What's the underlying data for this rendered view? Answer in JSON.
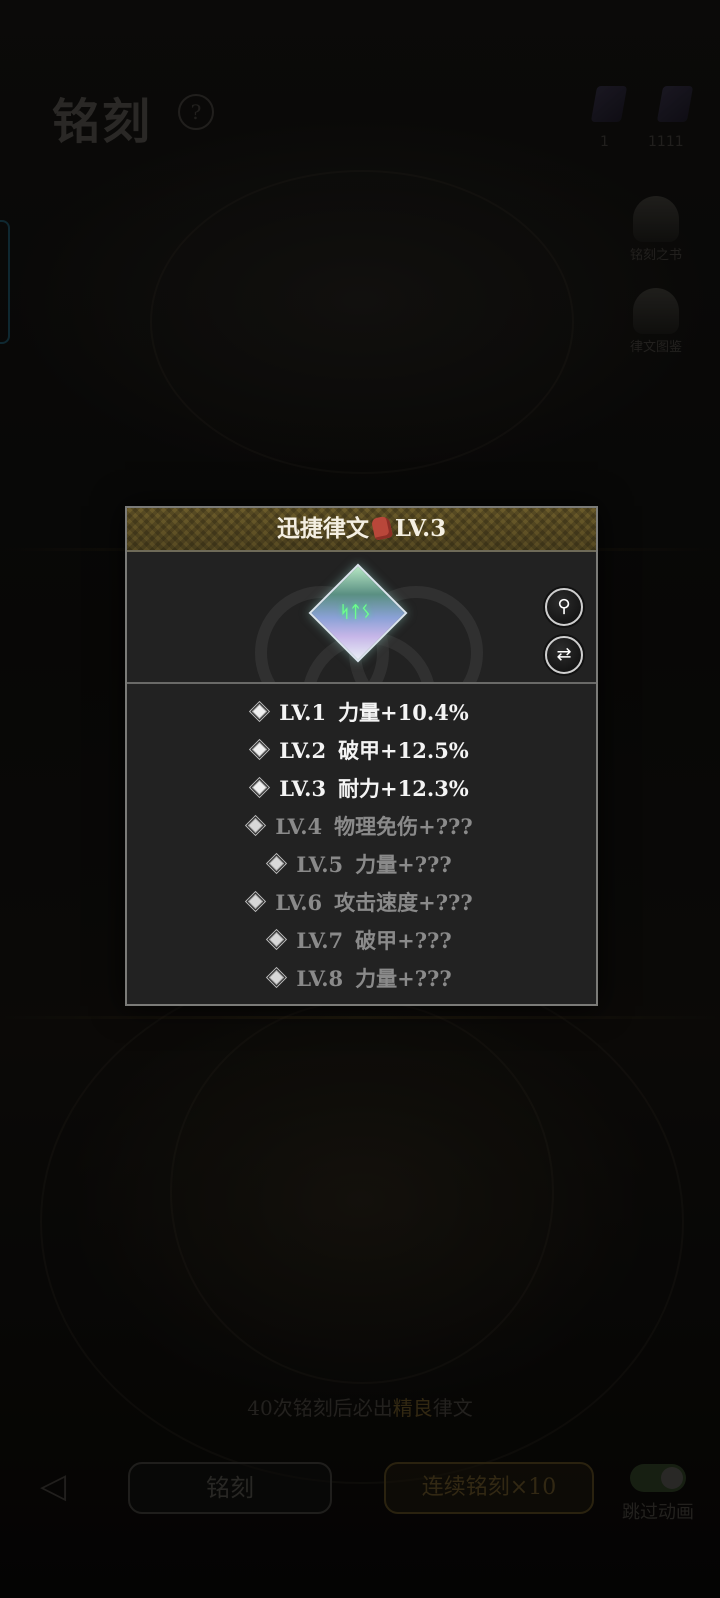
{
  "header": {
    "title": "铭刻",
    "help_glyph": "?",
    "resources": [
      {
        "value": "1"
      },
      {
        "value": "1111"
      }
    ],
    "right_buttons": [
      {
        "label": "铭刻之书"
      },
      {
        "label": "律文图鉴"
      }
    ]
  },
  "popup": {
    "title": "迅捷律文",
    "title_icon": "fist-icon",
    "level_label": "LV.3",
    "gem_runes": "ᛋᛏᛊ",
    "zoom_glyph": "⚲",
    "swap_glyph": "⇄",
    "levels": [
      {
        "lv": "LV.1",
        "effect": "力量+10.4%",
        "unlocked": true
      },
      {
        "lv": "LV.2",
        "effect": "破甲+12.5%",
        "unlocked": true
      },
      {
        "lv": "LV.3",
        "effect": "耐力+12.3%",
        "unlocked": true
      },
      {
        "lv": "LV.4",
        "effect": "物理免伤+???",
        "unlocked": false
      },
      {
        "lv": "LV.5",
        "effect": "力量+???",
        "unlocked": false
      },
      {
        "lv": "LV.6",
        "effect": "攻击速度+???",
        "unlocked": false
      },
      {
        "lv": "LV.7",
        "effect": "破甲+???",
        "unlocked": false
      },
      {
        "lv": "LV.8",
        "effect": "力量+???",
        "unlocked": false
      }
    ]
  },
  "footer": {
    "hint_prefix": "40次铭刻后必出",
    "hint_highlight": "精良",
    "hint_suffix": "律文",
    "back_glyph": "◁",
    "engrave_label": "铭刻",
    "engrave10_label": "连续铭刻×10",
    "skip_label": "跳过动画"
  },
  "colors": {
    "popup_bg": "#222222",
    "header_gold": "#6b5b2a",
    "unlocked_text": "#f4f4f4",
    "locked_text": "#8a8a8a",
    "rune_green": "#6dff8c"
  }
}
